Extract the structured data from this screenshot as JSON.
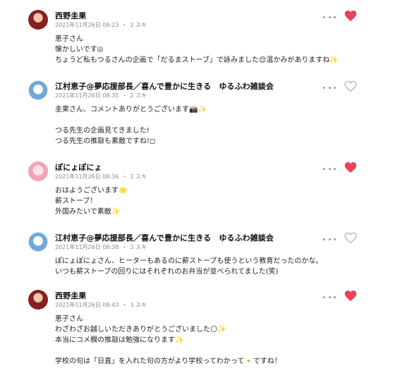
{
  "comments": [
    {
      "author": "西野圭果",
      "date": "2021年11月26日 08:23",
      "likes": "2 スキ",
      "liked": true,
      "lines": [
        "恵子さん",
        "懐かしいです◎",
        "ちょうど私もつるさんの企画で「だるまストーブ」で詠みました😊温かみがありますね✨"
      ]
    },
    {
      "author": "江村恵子@夢応援部長／喜んで豊かに生きる　ゆるふわ雑談会",
      "date": "2021年11月26日 08:35",
      "likes": "2 スキ",
      "liked": false,
      "lines": [
        "圭果さん、コメントありがとうございます📸✨",
        "",
        "つる先生の企画見てきました!",
        "つる先生の推敲も素敵ですね!◻"
      ]
    },
    {
      "author": "ぽにょぽにょ",
      "date": "2021年11月26日 08:36",
      "likes": "2 スキ",
      "liked": true,
      "lines": [
        "おはようございます🌟",
        "薪ストーブ！",
        "外国みたいで素敵✨"
      ]
    },
    {
      "author": "江村恵子@夢応援部長／喜んで豊かに生きる　ゆるふわ雑談会",
      "date": "2021年11月26日 08:38",
      "likes": "2 スキ",
      "liked": false,
      "lines": [
        "ぽにょぽにょさん、ヒーターもあるのに薪ストーブも使うという教育だったのかな。",
        "いつも薪ストーブの回りにはそれぞれのお弁当が並べられてました(笑)"
      ]
    },
    {
      "author": "西野圭果",
      "date": "2021年11月26日 08:43",
      "likes": "3 スキ",
      "liked": true,
      "lines": [
        "恵子さん",
        "わざわざお越しいただきありがとうございました🌕✨",
        "本当にコメ欄の推敲は勉強になります✨",
        "",
        "学校の句は「日直」を入れた句の方がより学校ってわかって🔸ですね！"
      ]
    }
  ],
  "colors": {
    "liked": "#e8435a",
    "unliked": "#b5b5b5"
  },
  "icons": {
    "more": "more-dots-icon",
    "like": "heart-icon"
  }
}
